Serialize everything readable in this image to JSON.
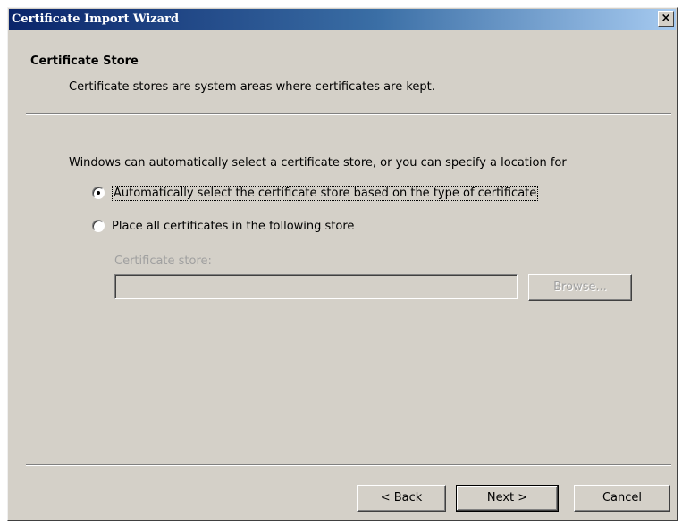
{
  "window": {
    "title": "Certificate Import Wizard",
    "close_glyph": "×"
  },
  "header": {
    "title": "Certificate Store",
    "subtitle": "Certificate stores are system areas where certificates are kept."
  },
  "body": {
    "intro": "Windows can automatically select a certificate store, or you can specify a location for",
    "options": [
      {
        "label": "Automatically select the certificate store based on the type of certificate",
        "checked": true
      },
      {
        "label": "Place all certificates in the following store",
        "checked": false
      }
    ],
    "store_label": "Certificate store:",
    "store_value": "",
    "browse_label": "Browse..."
  },
  "footer": {
    "back_label": "< Back",
    "next_label": "Next >",
    "cancel_label": "Cancel"
  },
  "colors": {
    "dialog_bg": "#d4d0c8",
    "titlebar_start": "#0a246a",
    "titlebar_end": "#a6caf0",
    "disabled_text": "#a0a0a0"
  }
}
